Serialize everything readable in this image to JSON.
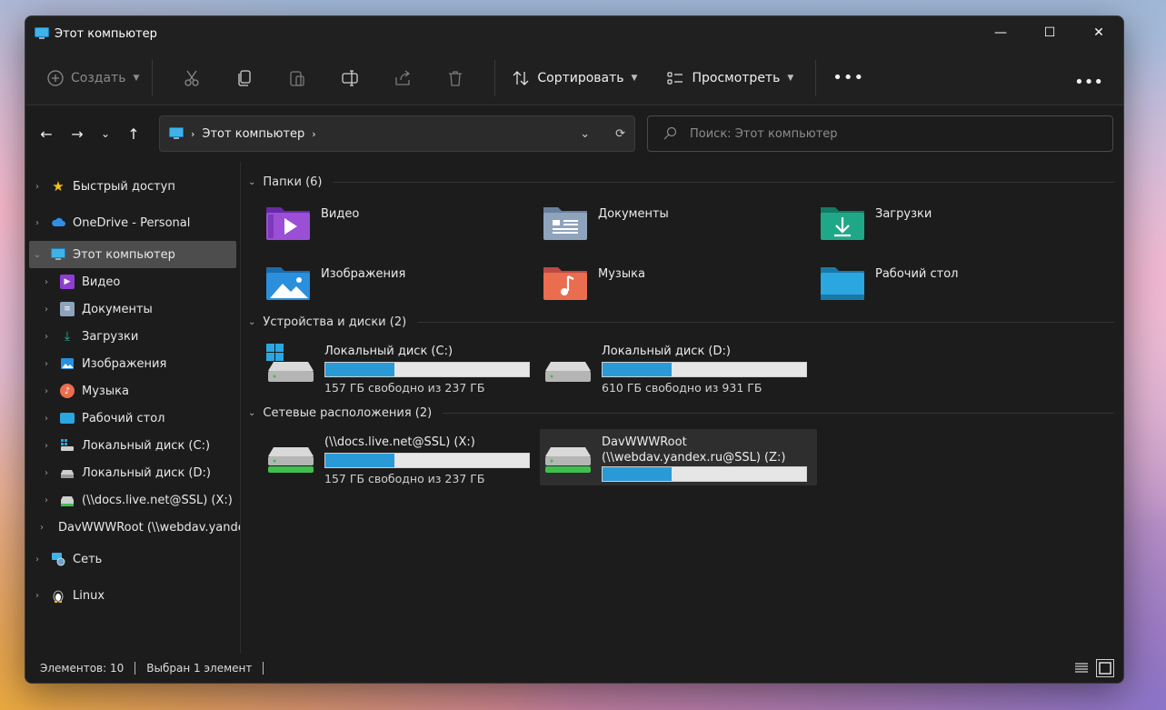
{
  "window": {
    "title": "Этот компьютер",
    "controls": {
      "minimize": "—",
      "maximize": "☐",
      "close": "✕"
    }
  },
  "toolbar": {
    "new_label": "Создать",
    "sort_label": "Сортировать",
    "view_label": "Просмотреть",
    "more": "•••"
  },
  "address": {
    "path": "Этот компьютер",
    "search_placeholder": "Поиск: Этот компьютер"
  },
  "sidebar": {
    "quick_access": "Быстрый доступ",
    "onedrive": "OneDrive - Personal",
    "this_pc": "Этот компьютер",
    "children": [
      "Видео",
      "Документы",
      "Загрузки",
      "Изображения",
      "Музыка",
      "Рабочий стол",
      "Локальный диск (C:)",
      "Локальный диск (D:)",
      "(\\\\docs.live.net@SSL) (X:)",
      "DavWWWRoot (\\\\webdav.yandex.ru@SSL) (Z:)"
    ],
    "network": "Сеть",
    "linux": "Linux"
  },
  "sections": {
    "folders_title": "Папки (6)",
    "devices_title": "Устройства и диски (2)",
    "network_title": "Сетевые расположения (2)"
  },
  "folders": [
    {
      "name": "Видео",
      "color": "#9a4fd6"
    },
    {
      "name": "Документы",
      "color": "#8fa3bd"
    },
    {
      "name": "Загрузки",
      "color": "#1fa888"
    },
    {
      "name": "Изображения",
      "color": "#2a8fdc"
    },
    {
      "name": "Музыка",
      "color": "#ea6d4f"
    },
    {
      "name": "Рабочий стол",
      "color": "#2aa6e0"
    }
  ],
  "devices": [
    {
      "name": "Локальный диск (C:)",
      "free": "157 ГБ свободно из 237 ГБ",
      "used_fraction": 0.34
    },
    {
      "name": "Локальный диск (D:)",
      "free": "610 ГБ свободно из 931 ГБ",
      "used_fraction": 0.34
    }
  ],
  "network_locations": [
    {
      "name": "(\\\\docs.live.net@SSL) (X:)",
      "free": "157 ГБ свободно из 237 ГБ",
      "used_fraction": 0.34
    },
    {
      "name": "DavWWWRoot",
      "name2": "(\\\\webdav.yandex.ru@SSL) (Z:)",
      "used_fraction": 0.34
    }
  ],
  "status": {
    "items": "Элементов: 10",
    "selected": "Выбран 1 элемент"
  }
}
